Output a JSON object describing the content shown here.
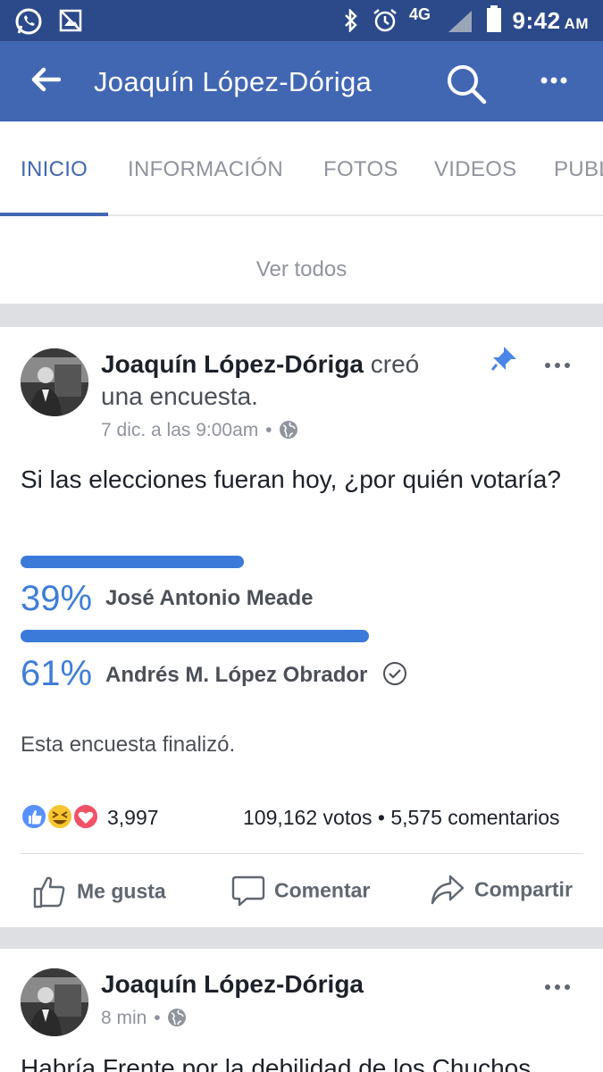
{
  "status_bar": {
    "time": "9:42",
    "ampm": "AM",
    "network": "4G"
  },
  "app_bar": {
    "title": "Joaquín López-Dóriga"
  },
  "tabs": [
    {
      "label": "INICIO",
      "active": true
    },
    {
      "label": "INFORMACIÓN",
      "active": false
    },
    {
      "label": "FOTOS",
      "active": false
    },
    {
      "label": "VIDEOS",
      "active": false
    },
    {
      "label": "PUBL",
      "active": false
    }
  ],
  "see_all": "Ver todos",
  "post": {
    "author": "Joaquín López-Dóriga",
    "action": "creó una encuesta.",
    "action_line1": "creó",
    "action_line2": "una encuesta.",
    "date": "7 dic. a las 9:00am",
    "date_separator": "•",
    "question": "Si las elecciones fueran hoy, ¿por quién votaría?",
    "poll_options": [
      {
        "percent": "39%",
        "value": 0.39,
        "name": "José Antonio Meade",
        "selected": false
      },
      {
        "percent": "61%",
        "value": 0.61,
        "name": "Andrés M. López Obrador",
        "selected": true
      }
    ],
    "status": "Esta encuesta finalizó.",
    "reactions_count": "3,997",
    "votes_comments": "109,162 votos • 5,575 comentarios",
    "actions": {
      "like": "Me gusta",
      "comment": "Comentar",
      "share": "Compartir"
    }
  },
  "post2": {
    "author": "Joaquín López-Dóriga",
    "time": "8 min",
    "time_separator": "•",
    "text": "Habría Frente por la debilidad de los Chuchos"
  },
  "colors": {
    "brand": "#4267b2",
    "status_bar": "#2c4a8a",
    "poll_bar": "#3b7ad9"
  }
}
